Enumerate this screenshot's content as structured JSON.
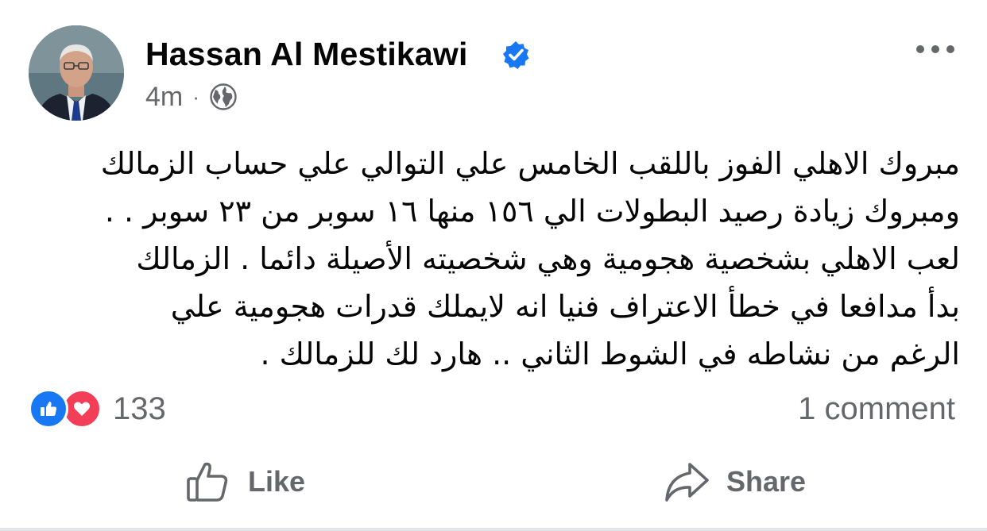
{
  "post": {
    "author": {
      "name": "Hassan Al Mestikawi",
      "verified_icon": "verified-badge-icon",
      "avatar_icon": "profile-photo"
    },
    "meta": {
      "time": "4m",
      "separator": "·",
      "audience_icon": "globe-icon"
    },
    "more_icon": "more-options-icon",
    "text_lines": [
      "مبروك الاهلي الفوز باللقب الخامس علي التوالي علي حساب الزمالك",
      "ومبروك زيادة رصيد البطولات الي ١٥٦ منها ١٦ سوبر من ٢٣ سوبر . .",
      "لعب الاهلي بشخصية هجومية وهي شخصيته الأصيلة دائما . الزمالك",
      "بدأ مدافعا في خطأ الاعتراف فنيا انه لايملك قدرات هجومية علي",
      "الرغم من نشاطه في الشوط الثاني .. هارد لك للزمالك ."
    ],
    "reactions": {
      "icons": [
        "like-reaction-icon",
        "love-reaction-icon"
      ],
      "count": "133"
    },
    "comments": {
      "label": "1 comment"
    },
    "actions": {
      "like_label": "Like",
      "share_label": "Share"
    }
  },
  "colors": {
    "facebook_blue": "#1877f2",
    "love_red": "#f33e58",
    "secondary_text": "#65676b",
    "primary_text": "#050505",
    "divider": "#e4e6eb"
  }
}
